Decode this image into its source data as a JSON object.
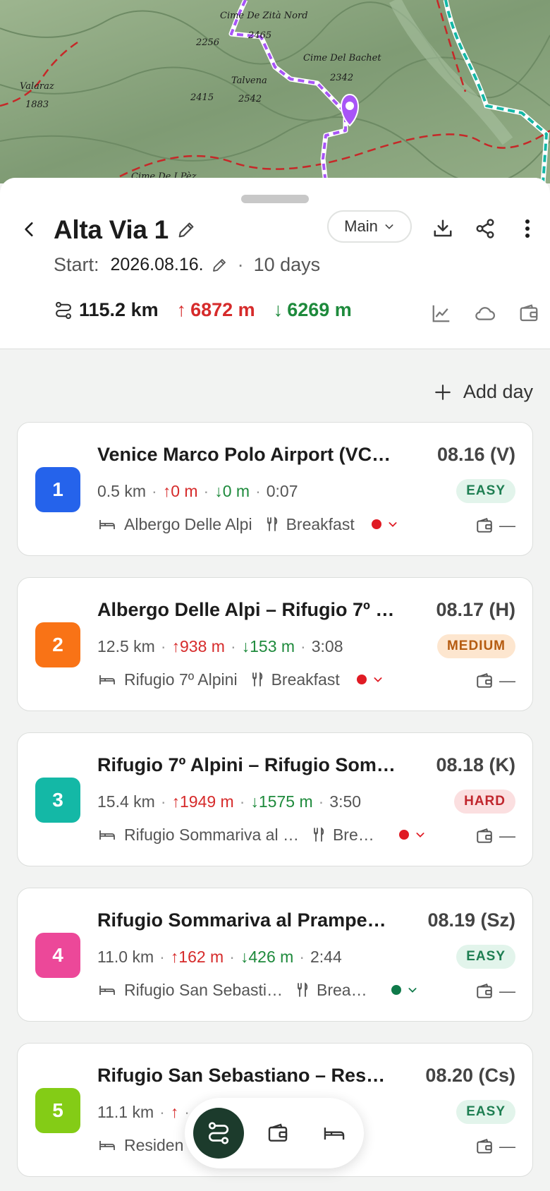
{
  "map": {
    "labels": [
      "Cime De Zità Nord",
      "2256",
      "2465",
      "Cime Del Bachet",
      "Valaraz",
      "1883",
      "Talvena",
      "2342",
      "2415",
      "2542",
      "Cime De I Pèz"
    ]
  },
  "header": {
    "title": "Alta Via 1",
    "variant_label": "Main",
    "start_label": "Start:",
    "start_date": "2026.08.16.",
    "duration": "10 days",
    "total_distance": "115.2 km",
    "total_ascent": "6872 m",
    "total_descent": "6269 m"
  },
  "add_day_label": "Add day",
  "days": [
    {
      "number": "1",
      "color": "#2563eb",
      "title": "Venice Marco Polo Airport (VC…",
      "date": "08.16 (V)",
      "distance": "0.5 km",
      "ascent": "0 m",
      "descent": "0 m",
      "time": "0:07",
      "difficulty": "EASY",
      "difficulty_class": "easy",
      "lodging": "Albergo Delle Alpi",
      "meal": "Breakfast",
      "status_color": "#e01b24",
      "budget": "—"
    },
    {
      "number": "2",
      "color": "#f97316",
      "title": "Albergo Delle Alpi – Rifugio 7º …",
      "date": "08.17 (H)",
      "distance": "12.5 km",
      "ascent": "938 m",
      "descent": "153 m",
      "time": "3:08",
      "difficulty": "MEDIUM",
      "difficulty_class": "medium",
      "lodging": "Rifugio 7º Alpini",
      "meal": "Breakfast",
      "status_color": "#e01b24",
      "budget": "—"
    },
    {
      "number": "3",
      "color": "#14b8a6",
      "title": "Rifugio 7º Alpini – Rifugio Som…",
      "date": "08.18 (K)",
      "distance": "15.4 km",
      "ascent": "1949 m",
      "descent": "1575 m",
      "time": "3:50",
      "difficulty": "HARD",
      "difficulty_class": "hard",
      "lodging": "Rifugio Sommariva al …",
      "meal": "Brea…",
      "status_color": "#e01b24",
      "budget": "—"
    },
    {
      "number": "4",
      "color": "#ec4899",
      "title": "Rifugio Sommariva al Prampe…",
      "date": "08.19 (Sz)",
      "distance": "11.0 km",
      "ascent": "162 m",
      "descent": "426 m",
      "time": "2:44",
      "difficulty": "EASY",
      "difficulty_class": "easy",
      "lodging": "Rifugio San Sebasti…",
      "meal": "Breakf…",
      "status_color": "#0f7a4a",
      "budget": "—"
    },
    {
      "number": "5",
      "color": "#84cc16",
      "title": "Rifugio San Sebastiano – Res…",
      "date": "08.20 (Cs)",
      "distance": "11.1 km",
      "ascent": "",
      "descent": "6",
      "time": "",
      "difficulty": "EASY",
      "difficulty_class": "easy",
      "lodging": "Residen",
      "meal": "ast",
      "status_color": "#0f7a4a",
      "budget": "—"
    }
  ],
  "icons": {
    "back": "chevron-left-icon",
    "edit": "pencil-icon",
    "download": "download-icon",
    "share": "share-icon",
    "more": "more-vertical-icon",
    "route": "route-icon",
    "chart": "chart-line-icon",
    "weather": "cloud-icon",
    "budget": "wallet-icon",
    "lodging": "bed-icon",
    "meal": "cutlery-icon"
  }
}
